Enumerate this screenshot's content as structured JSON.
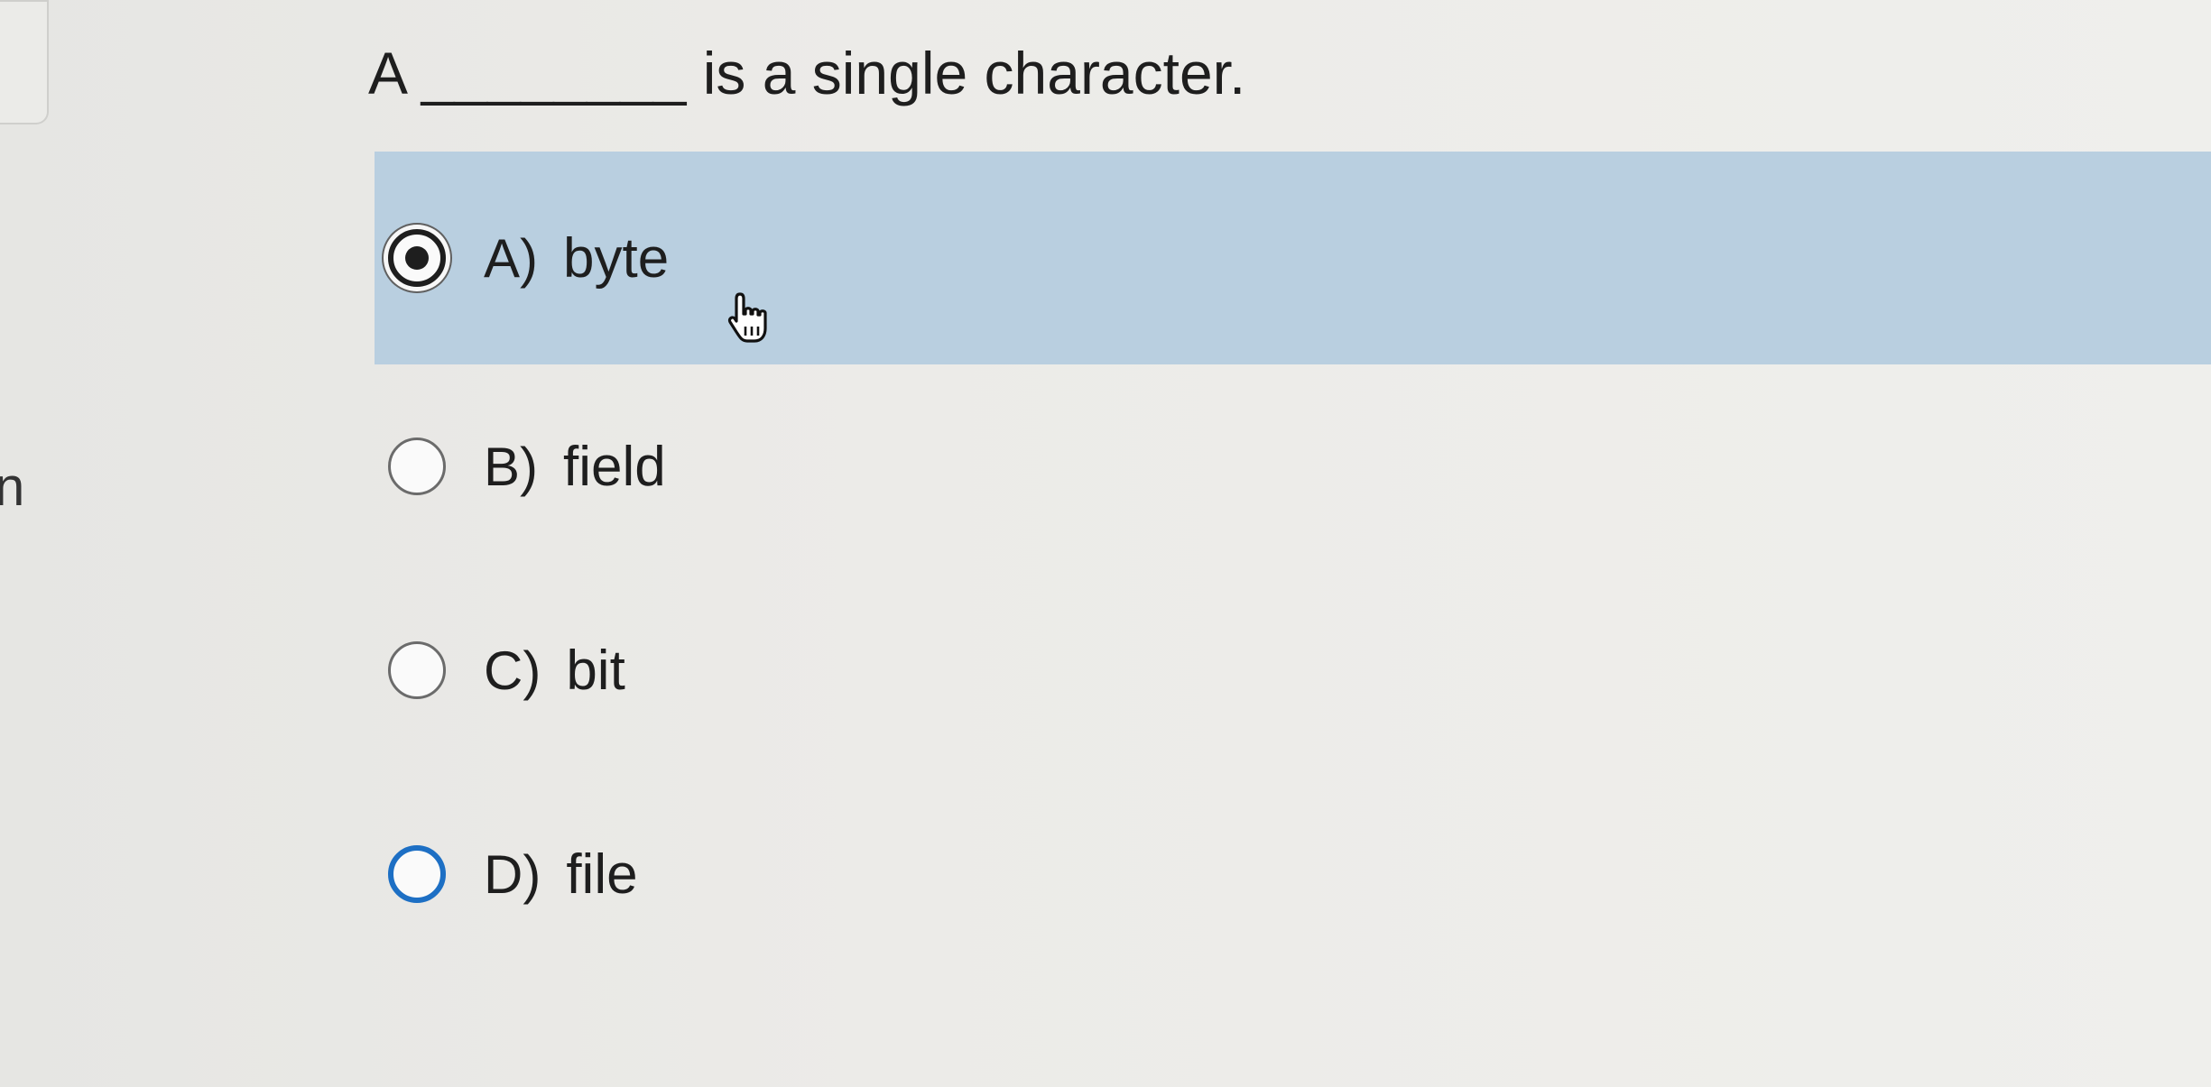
{
  "question": {
    "text": "A ________ is a single character."
  },
  "sidebar": {
    "edge_char": "n"
  },
  "options": [
    {
      "letter": "A)",
      "text": "byte",
      "selected": true
    },
    {
      "letter": "B)",
      "text": "field",
      "selected": false
    },
    {
      "letter": "C)",
      "text": "bit",
      "selected": false
    },
    {
      "letter": "D)",
      "text": "file",
      "selected": false
    }
  ],
  "colors": {
    "selected_row": "#b9cfe0",
    "focus_ring": "#1d6fc4",
    "text": "#1e1e1e"
  },
  "icons": {
    "cursor": "hand-pointer-icon"
  }
}
